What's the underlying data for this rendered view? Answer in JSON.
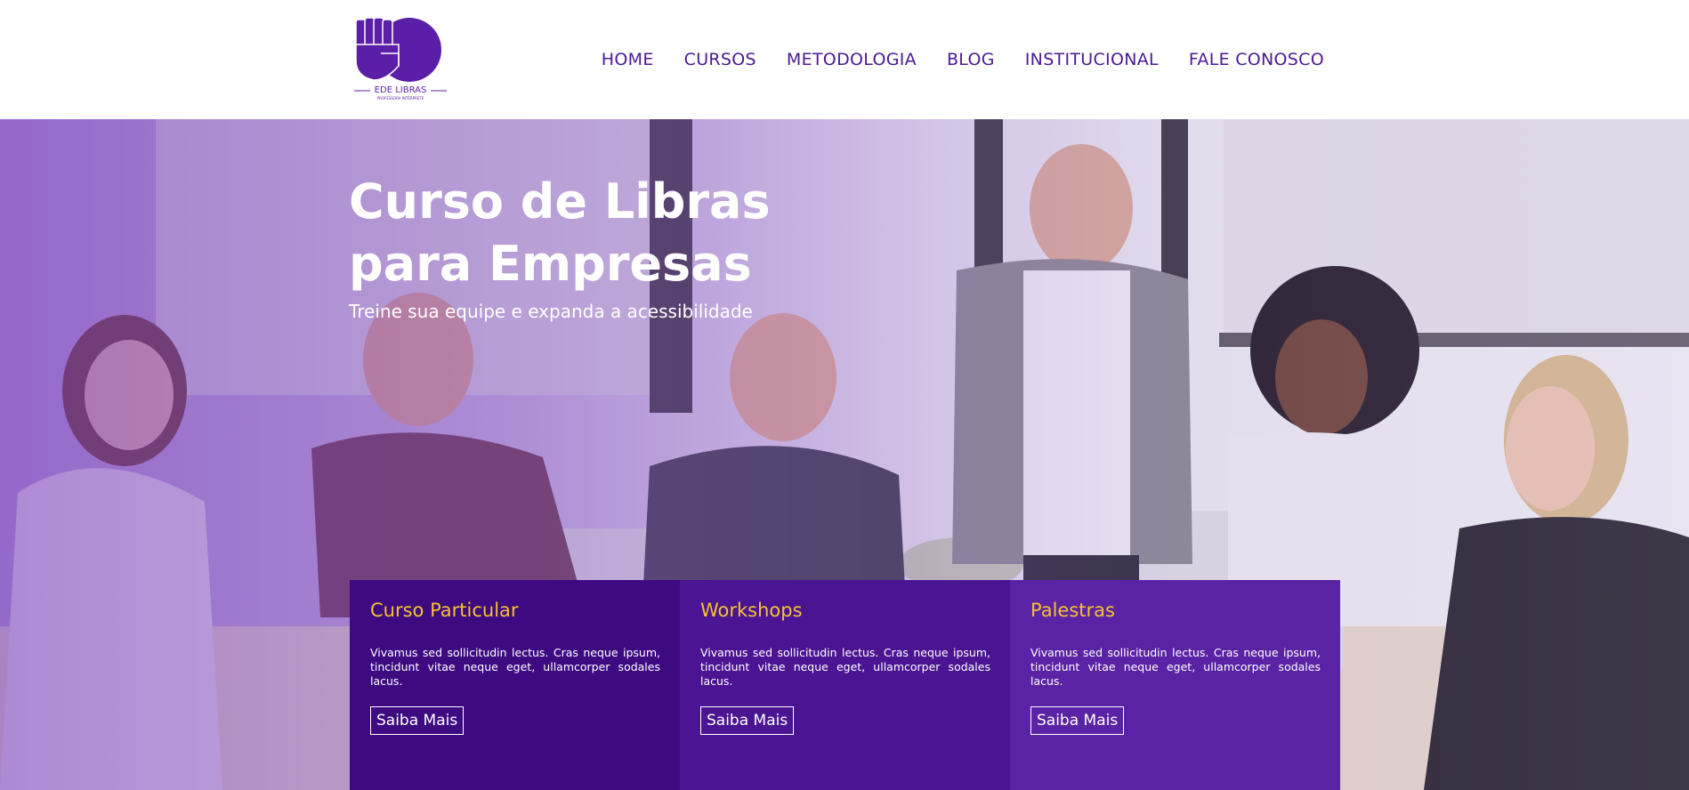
{
  "brand": {
    "name": "EDE LIBRAS",
    "tagline": "PROFESSORA INTÉRPRETE",
    "color": "#5a1fa6"
  },
  "nav": {
    "items": [
      "HOME",
      "CURSOS",
      "METODOLOGIA",
      "BLOG",
      "INSTITUCIONAL",
      "FALE CONOSCO"
    ]
  },
  "hero": {
    "title_line1": "Curso de Libras",
    "title_line2": "para Empresas",
    "subtitle": "Treine sua equipe e expanda a acessibilidade"
  },
  "cards": [
    {
      "title": "Curso Particular",
      "text": "Vivamus sed sollicitudin lectus. Cras neque ipsum, tincidunt vitae neque eget, ullamcorper sodales lacus.",
      "button": "Saiba Mais"
    },
    {
      "title": "Workshops",
      "text": "Vivamus sed sollicitudin lectus. Cras neque ipsum, tincidunt vitae neque eget, ullamcorper sodales lacus.",
      "button": "Saiba Mais"
    },
    {
      "title": "Palestras",
      "text": "Vivamus sed sollicitudin lectus. Cras neque ipsum, tincidunt vitae neque eget, ullamcorper sodales lacus.",
      "button": "Saiba Mais"
    }
  ],
  "colors": {
    "accent": "#f5c232",
    "purple_dark": "#3d0a82",
    "purple_mid": "#4a1492",
    "purple_light": "#5a22a4",
    "nav_text": "#4b1a92"
  }
}
